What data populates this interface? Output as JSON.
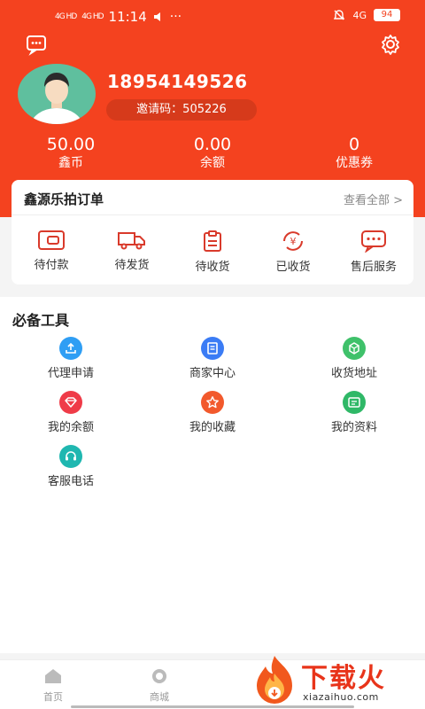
{
  "status_bar": {
    "signal_1": "4G HD",
    "signal_2": "4G HD",
    "time": "11:14",
    "dots": "···",
    "network": "4G",
    "battery": "94"
  },
  "profile": {
    "phone": "18954149526",
    "invite_code": "邀请码：505226"
  },
  "stats": [
    {
      "value": "50.00",
      "label": "鑫币"
    },
    {
      "value": "0.00",
      "label": "余额"
    },
    {
      "value": "0",
      "label": "优惠券"
    }
  ],
  "orders": {
    "title": "鑫源乐拍订单",
    "view_all": "查看全部 >",
    "items": [
      {
        "label": "待付款",
        "icon": "wallet-icon"
      },
      {
        "label": "待发货",
        "icon": "truck-icon"
      },
      {
        "label": "待收货",
        "icon": "clipboard-icon"
      },
      {
        "label": "已收货",
        "icon": "yuan-exchange-icon"
      },
      {
        "label": "售后服务",
        "icon": "chat-icon"
      }
    ]
  },
  "tools": {
    "title": "必备工具",
    "items": [
      {
        "label": "代理申请",
        "icon": "upload-icon",
        "color": "#2f9ef4"
      },
      {
        "label": "商家中心",
        "icon": "document-icon",
        "color": "#3b7cf5"
      },
      {
        "label": "收货地址",
        "icon": "box-icon",
        "color": "#3fc16a"
      },
      {
        "label": "我的余额",
        "icon": "diamond-icon",
        "color": "#ef3b48"
      },
      {
        "label": "我的收藏",
        "icon": "star-icon",
        "color": "#f2592c"
      },
      {
        "label": "我的资料",
        "icon": "card-icon",
        "color": "#2fb867"
      },
      {
        "label": "客服电话",
        "icon": "headset-icon",
        "color": "#1fb7b0"
      }
    ]
  },
  "tabbar": {
    "tabs": [
      {
        "label": "首页"
      },
      {
        "label": "商城"
      }
    ]
  },
  "watermark": {
    "text": "下载火",
    "domain": "xiazaihuo.com"
  },
  "colors": {
    "header": "#f4421f",
    "invite_pill": "#d63a1b",
    "accent": "#e8341a"
  }
}
